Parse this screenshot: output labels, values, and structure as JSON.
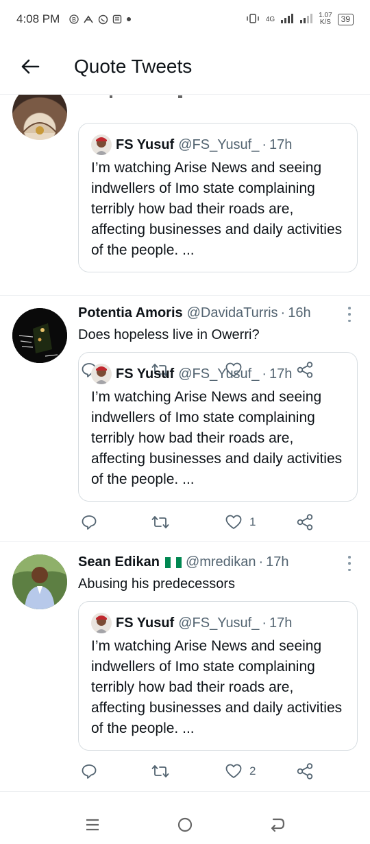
{
  "status_bar": {
    "time": "4:08 PM",
    "network": "4G",
    "speed_value": "1.07",
    "speed_unit": "K/S",
    "battery": "39"
  },
  "header": {
    "title": "Quote Tweets",
    "back_icon": "arrow-left-icon"
  },
  "quoted_tweet": {
    "name": "FS Yusuf",
    "handle": "@FS_Yusuf_",
    "separator": "·",
    "time": "17h",
    "text": "I’m watching Arise News and seeing indwellers of Imo state complaining terribly how bad their roads are, affecting businesses and daily activities of the people. ..."
  },
  "tweets": [
    {
      "name": "",
      "handle": "",
      "time": "",
      "text": "",
      "likes": "",
      "truncated": true
    },
    {
      "name": "Potentia Amoris",
      "handle": "@DavidaTurris",
      "separator": "·",
      "time": "16h",
      "text": "Does hopeless live in Owerri?",
      "likes": "1"
    },
    {
      "name": "Sean Edikan",
      "handle": "@mredikan",
      "separator": "·",
      "time": "17h",
      "text": "Abusing his predecessors",
      "likes": "2"
    }
  ],
  "icons": {
    "reply": "reply-icon",
    "retweet": "retweet-icon",
    "like": "heart-icon",
    "share": "share-icon",
    "more": "more-vertical-icon"
  },
  "colors": {
    "text": "#0f1419",
    "secondary": "#536471",
    "border": "#d7dde1",
    "flag_green": "#008751"
  }
}
